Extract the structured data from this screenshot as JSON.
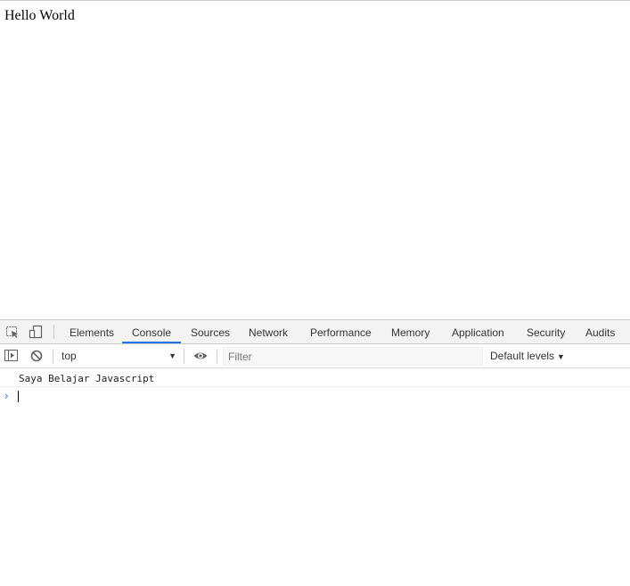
{
  "page": {
    "text": "Hello World"
  },
  "devtools": {
    "tabs": [
      {
        "label": "Elements"
      },
      {
        "label": "Console"
      },
      {
        "label": "Sources"
      },
      {
        "label": "Network"
      },
      {
        "label": "Performance"
      },
      {
        "label": "Memory"
      },
      {
        "label": "Application"
      },
      {
        "label": "Security"
      },
      {
        "label": "Audits"
      }
    ],
    "active_tab": "Console",
    "accent_color": "#1a73e8",
    "toolbar": {
      "context": "top",
      "filter_placeholder": "Filter",
      "levels_label": "Default levels"
    },
    "icons": [
      "inspect-element-icon",
      "device-toolbar-icon",
      "sidebar-toggle-icon",
      "clear-console-icon",
      "eye-icon",
      "chevron-right-icon"
    ],
    "console": {
      "messages": [
        "Saya Belajar Javascript"
      ]
    }
  }
}
